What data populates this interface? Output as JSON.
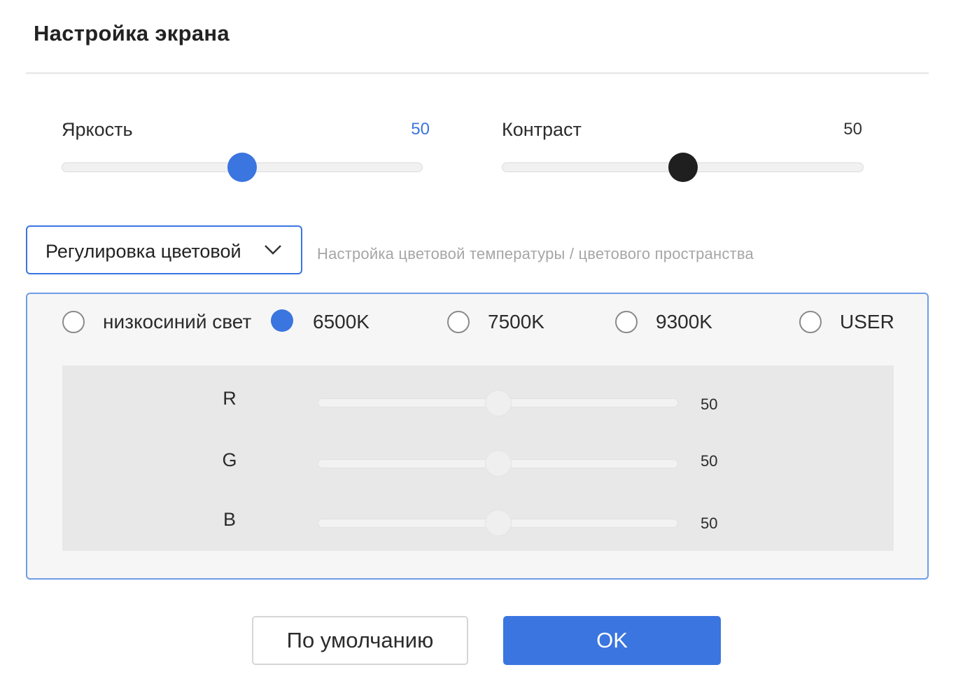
{
  "dialog": {
    "title": "Настройка экрана"
  },
  "sliders": {
    "brightness": {
      "label": "Яркость",
      "value": "50",
      "level": 50,
      "thumb_color": "#3a75e0"
    },
    "contrast": {
      "label": "Контраст",
      "value": "50",
      "level": 50,
      "thumb_color": "#1f1f1f"
    }
  },
  "color_mode": {
    "selected": "Регулировка цветовой",
    "hint": "Настройка цветовой температуры / цветового пространства"
  },
  "presets": [
    {
      "label": "низкосиний свет",
      "checked": false
    },
    {
      "label": "6500K",
      "checked": true
    },
    {
      "label": "7500K",
      "checked": false
    },
    {
      "label": "9300K",
      "checked": false
    },
    {
      "label": "USER",
      "checked": false
    }
  ],
  "rgb": [
    {
      "channel": "R",
      "value": "50",
      "level": 50
    },
    {
      "channel": "G",
      "value": "50",
      "level": 50
    },
    {
      "channel": "B",
      "value": "50",
      "level": 50
    }
  ],
  "buttons": {
    "default_label": "По умолчанию",
    "ok_label": "OK"
  },
  "colors": {
    "accent": "#3a75e0",
    "panel_border": "#6f9de6"
  },
  "icons": {
    "dropdown": "chevron-down-icon"
  }
}
